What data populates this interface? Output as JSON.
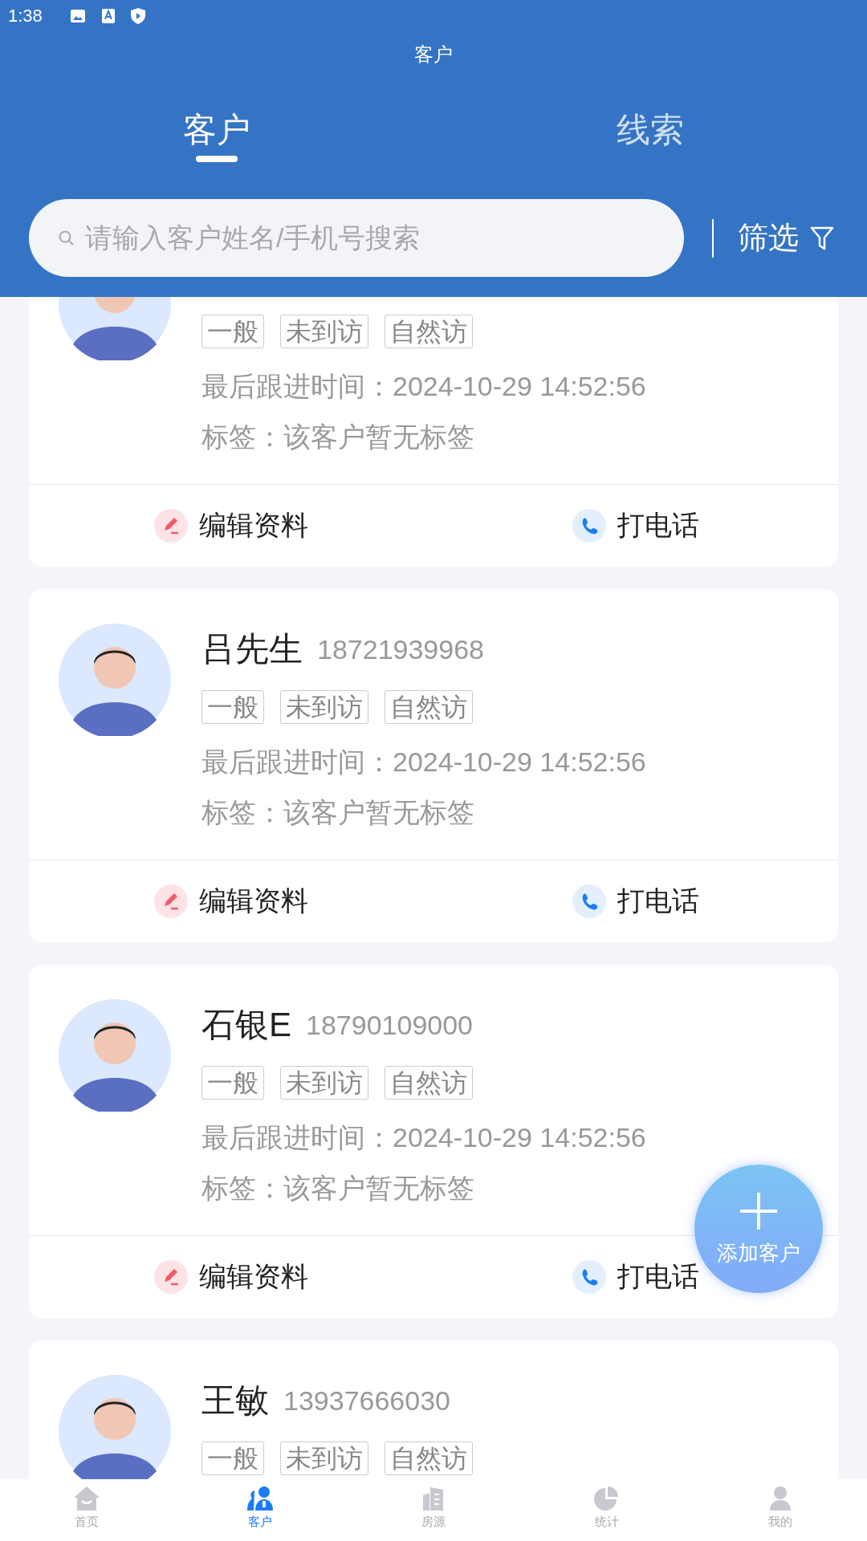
{
  "status_bar": {
    "time": "1:38"
  },
  "header": {
    "title": "客户"
  },
  "tabs": [
    {
      "label": "客户",
      "selected": true
    },
    {
      "label": "线索",
      "selected": false
    }
  ],
  "search": {
    "placeholder": "请输入客户姓名/手机号搜索"
  },
  "filter_button": {
    "label": "筛选"
  },
  "customers": [
    {
      "tags": [
        "一般",
        "未到访",
        "自然访"
      ],
      "last_follow_up": "最后跟进时间：2024-10-29 14:52:56",
      "labels": "标签：该客户暂无标签",
      "actions": [
        {
          "kind": "edit",
          "label": "编辑资料"
        },
        {
          "kind": "call",
          "label": "打电话"
        }
      ]
    },
    {
      "name": "吕先生",
      "phone": "18721939968",
      "tags": [
        "一般",
        "未到访",
        "自然访"
      ],
      "last_follow_up": "最后跟进时间：2024-10-29 14:52:56",
      "labels": "标签：该客户暂无标签",
      "actions": [
        {
          "kind": "edit",
          "label": "编辑资料"
        },
        {
          "kind": "call",
          "label": "打电话"
        }
      ]
    },
    {
      "name": "石银E",
      "phone": "18790109000",
      "tags": [
        "一般",
        "未到访",
        "自然访"
      ],
      "last_follow_up": "最后跟进时间：2024-10-29 14:52:56",
      "labels": "标签：该客户暂无标签",
      "actions": [
        {
          "kind": "edit",
          "label": "编辑资料"
        },
        {
          "kind": "call",
          "label": "打电话"
        }
      ]
    },
    {
      "name": "王敏",
      "phone": "13937666030",
      "tags": [
        "一般",
        "未到访",
        "自然访"
      ]
    }
  ],
  "add_button": {
    "label": "添加客户"
  },
  "nav": [
    {
      "kind": "home",
      "label": "首页",
      "selected": false
    },
    {
      "kind": "customers",
      "label": "客户",
      "selected": true
    },
    {
      "kind": "buildings",
      "label": "房源",
      "selected": false
    },
    {
      "kind": "stats",
      "label": "统计",
      "selected": false
    },
    {
      "kind": "profile",
      "label": "我的",
      "selected": false
    }
  ]
}
